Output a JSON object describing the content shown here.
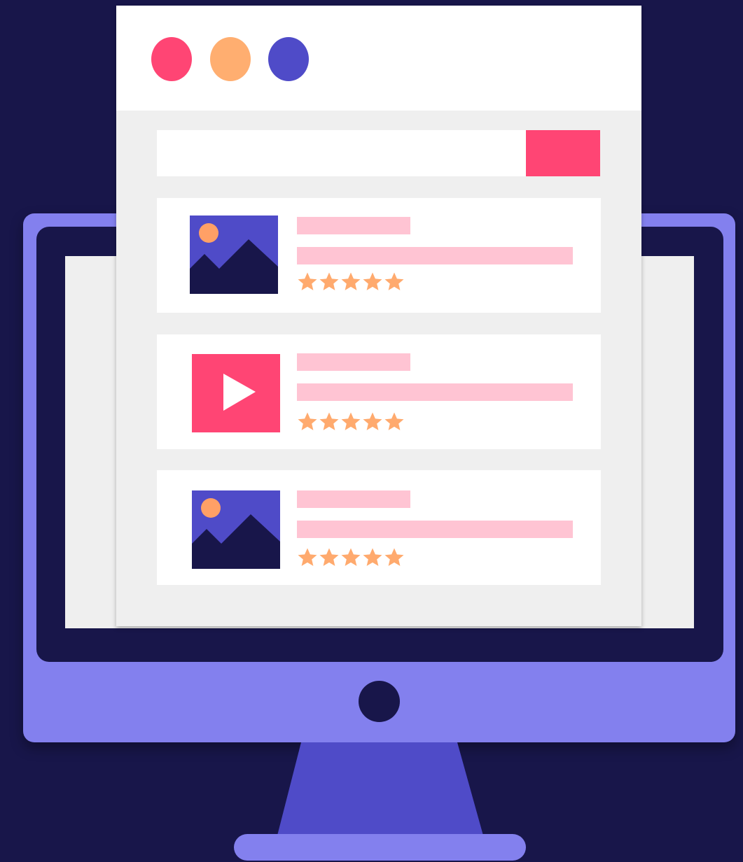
{
  "colors": {
    "background": "#18164a",
    "monitor_body": "#8380ee",
    "monitor_bezel": "#18164a",
    "monitor_screen": "#efefef",
    "monitor_neck": "#4f4bc8",
    "window_dot_red": "#ff4574",
    "window_dot_orange": "#ffae70",
    "window_dot_indigo": "#4f4bc8",
    "search_button": "#ff4574",
    "text_placeholder": "#ffc4d3",
    "star": "#ffaa6e",
    "image_sky": "#4f4bc8",
    "image_mountain": "#18164a",
    "image_sun": "#ffa066",
    "video_bg": "#ff4574",
    "video_play": "#ffffff"
  },
  "browser": {
    "window_dots": [
      "red",
      "orange",
      "indigo"
    ]
  },
  "search": {
    "button_icon": "search-button-blank"
  },
  "results": [
    {
      "thumbnail": "image-icon",
      "rating": 5
    },
    {
      "thumbnail": "video-play-icon",
      "rating": 5
    },
    {
      "thumbnail": "image-icon",
      "rating": 5
    }
  ]
}
